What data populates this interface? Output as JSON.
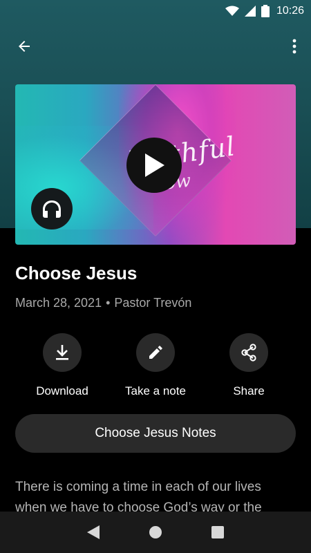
{
  "status_bar": {
    "time": "10:26"
  },
  "app_bar": {
    "back_icon": "arrow-left-icon",
    "more_icon": "more-vert-icon"
  },
  "sermon": {
    "title": "Choose Jesus",
    "date": "March 28, 2021",
    "separator": "•",
    "speaker": "Pastor Trevón",
    "artwork_text_1": "Faithful",
    "artwork_text_2": "Flow"
  },
  "actions": [
    {
      "label": "Download",
      "icon": "download-icon"
    },
    {
      "label": "Take a note",
      "icon": "pencil-icon"
    },
    {
      "label": "Share",
      "icon": "share-icon"
    }
  ],
  "notes_button": {
    "label": "Choose Jesus Notes"
  },
  "description": "There is coming a time in each of our lives when we have to choose God’s way or the",
  "nav": {
    "back": "nav-back-icon",
    "home": "nav-home-icon",
    "recents": "nav-recents-icon"
  },
  "colors": {
    "header_bg": "#1f5a61",
    "surface": "#2a2a2a",
    "background": "#000000",
    "muted_text": "#a9a9a9"
  }
}
